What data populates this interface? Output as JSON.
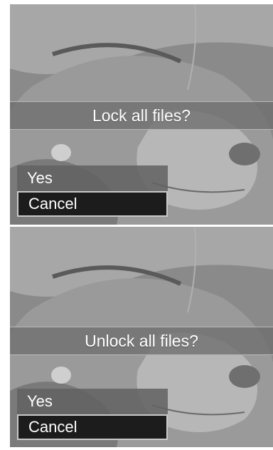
{
  "dialogs": [
    {
      "prompt": "Lock all files?",
      "options": [
        "Yes",
        "Cancel"
      ],
      "selected": "Cancel"
    },
    {
      "prompt": "Unlock all files?",
      "options": [
        "Yes",
        "Cancel"
      ],
      "selected": "Cancel"
    }
  ],
  "colors": {
    "selection_bg": "#1c1c1c",
    "selection_border": "#c9c9c9",
    "text": "#ffffff"
  }
}
